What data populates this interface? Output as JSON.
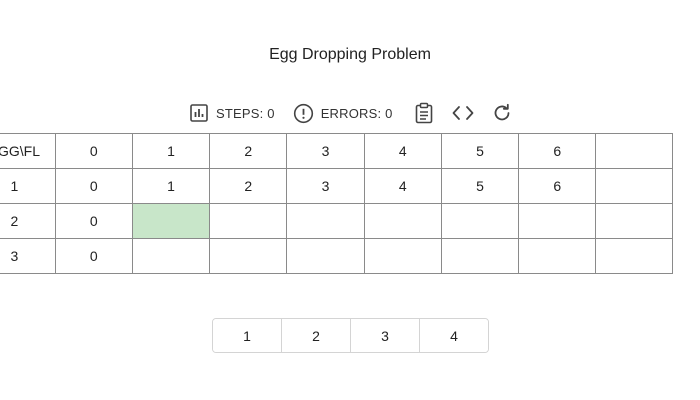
{
  "title": "Egg Dropping Problem",
  "toolbar": {
    "steps_label": "STEPS: 0",
    "errors_label": "ERRORS: 0",
    "icons": [
      "bar-chart-icon",
      "alert-circle-icon",
      "clipboard-icon",
      "code-icon",
      "refresh-icon"
    ]
  },
  "table": {
    "corner": "EGG\\FL",
    "header": [
      "0",
      "1",
      "2",
      "3",
      "4",
      "5",
      "6",
      ""
    ],
    "rows": [
      {
        "label": "1",
        "cells": [
          "0",
          "1",
          "2",
          "3",
          "4",
          "5",
          "6",
          ""
        ]
      },
      {
        "label": "2",
        "cells": [
          "0",
          "",
          "",
          "",
          "",
          "",
          "",
          ""
        ]
      },
      {
        "label": "3",
        "cells": [
          "0",
          "",
          "",
          "",
          "",
          "",
          "",
          ""
        ]
      }
    ],
    "active_cell_color": "#c8e6c9"
  },
  "pagination": {
    "pages": [
      "1",
      "2",
      "3",
      "4"
    ]
  }
}
